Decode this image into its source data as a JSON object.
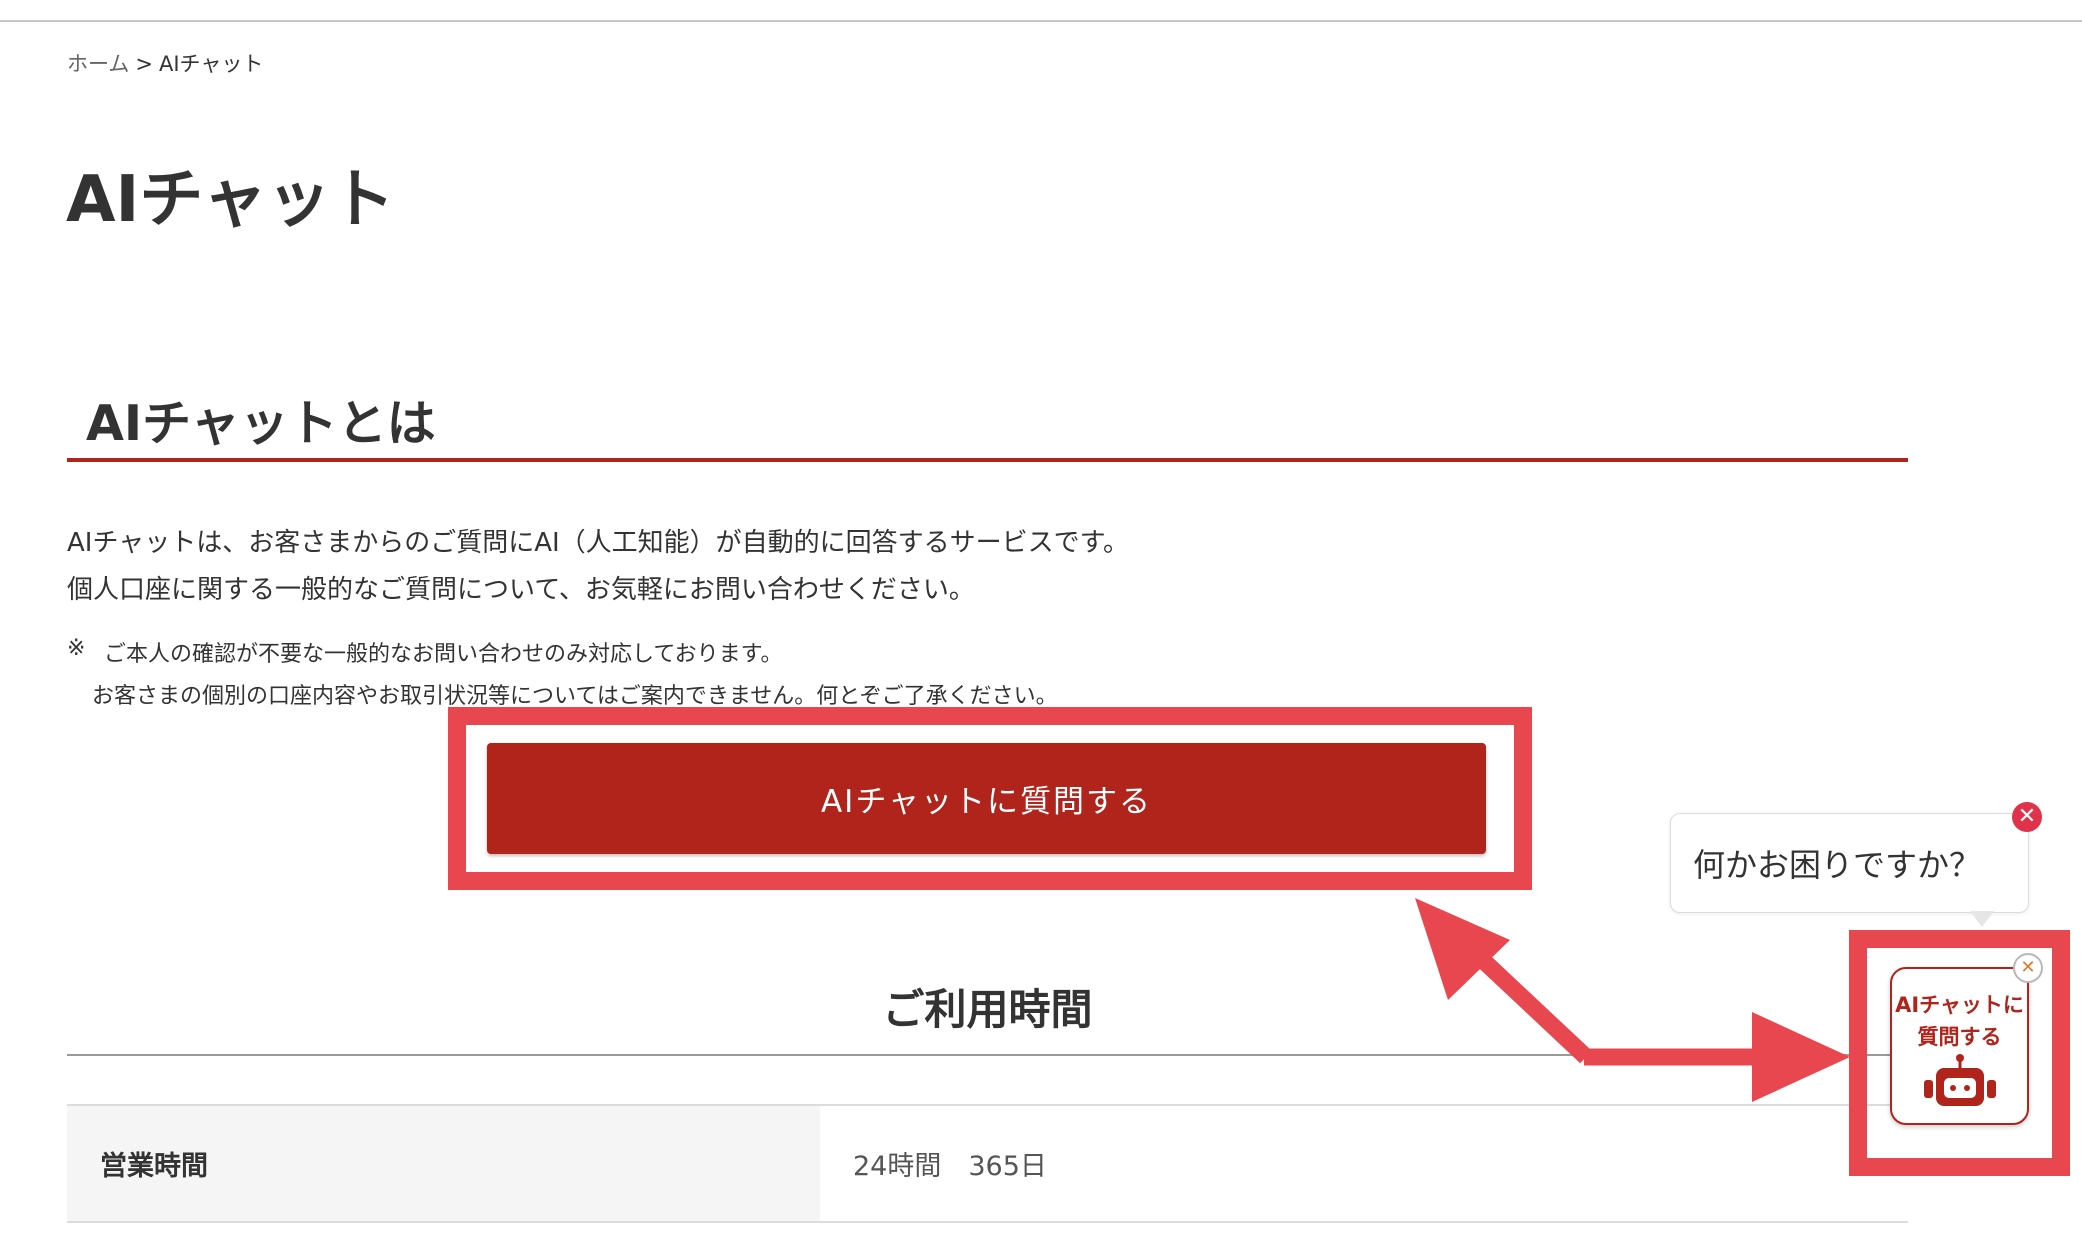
{
  "breadcrumb": {
    "home": "ホーム",
    "separator": ">",
    "current": "AIチャット"
  },
  "page_title": "AIチャット",
  "section": {
    "heading": "AIチャットとは",
    "paragraph_1": "AIチャットは、お客さまからのご質問にAI（人工知能）が自動的に回答するサービスです。",
    "paragraph_2": "個人口座に関する一般的なご質問について、お気軽にお問い合わせください。",
    "note_mark": "※",
    "note_line_1": "ご本人の確認が不要な一般的なお問い合わせのみ対応しております。",
    "note_line_2": "お客さまの個別の口座内容やお取引状況等についてはご案内できません。何とぞご了承ください。"
  },
  "ask_button_label": "AIチャットに質問する",
  "hours": {
    "heading": "ご利用時間",
    "rows": [
      {
        "label": "営業時間",
        "value": "24時間　365日"
      }
    ]
  },
  "chat_widget": {
    "bubble_text": "何かお困りですか？",
    "bubble_close": "✕",
    "launcher_label": "AIチャットに\n質問する",
    "launcher_close": "✕",
    "icon": "robot-icon"
  },
  "colors": {
    "brand_red": "#b0241b",
    "annotation_red": "#e8474f",
    "close_red": "#e0334b"
  }
}
